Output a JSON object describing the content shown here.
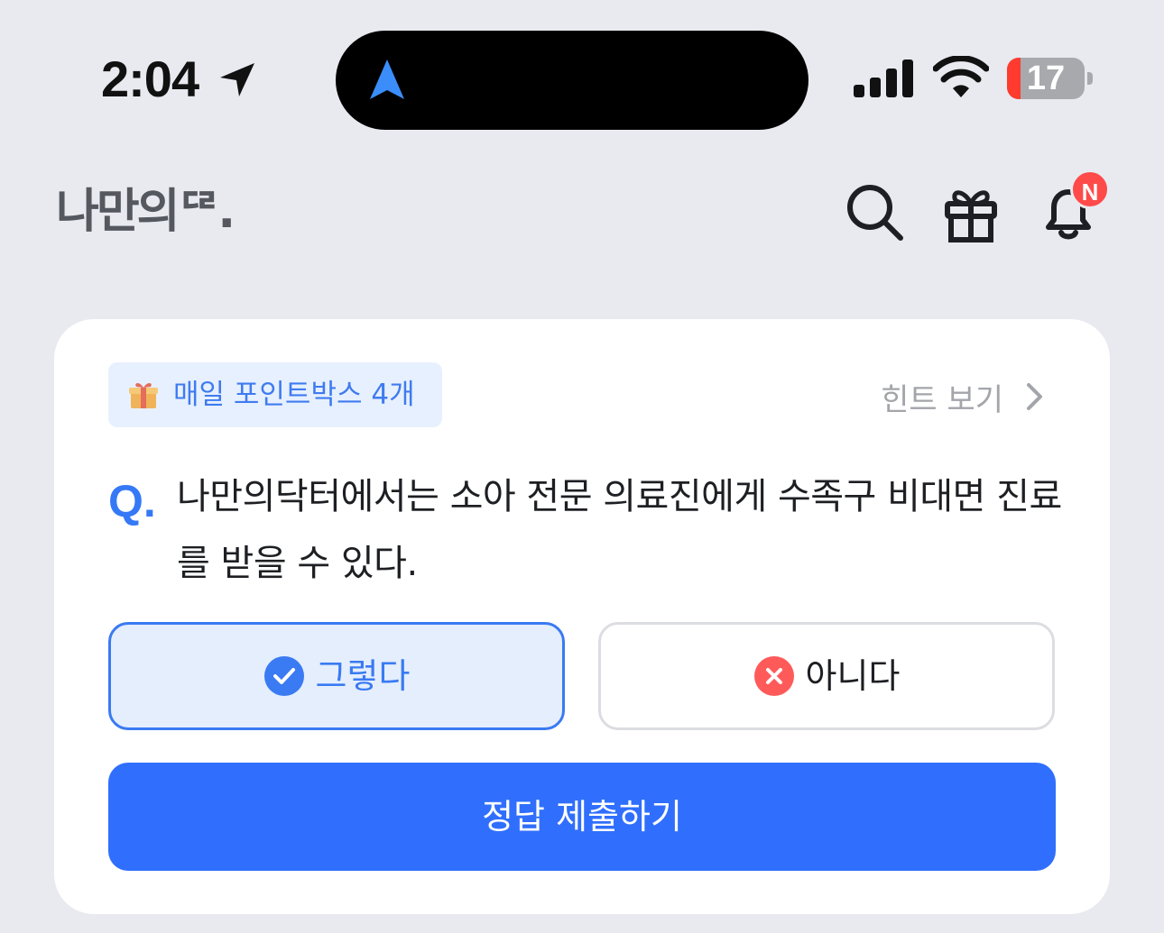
{
  "status_bar": {
    "time": "2:04",
    "battery_level": 17,
    "battery_label": "17"
  },
  "header": {
    "logo_text": "나만의ᄃᄅ."
  },
  "notification_badge": "N",
  "quiz": {
    "pointbox_label": "매일 포인트박스 4개",
    "hint_label": "힌트 보기",
    "q_marker": "Q.",
    "question": "나만의닥터에서는 소아 전문 의료진에게 수족구 비대면 진료를 받을 수 있다.",
    "yes_label": "그렇다",
    "no_label": "아니다",
    "selected": "yes",
    "submit_label": "정답 제출하기"
  },
  "colors": {
    "accent": "#306ffd",
    "selected_blue": "#3a7af2",
    "badge_red": "#ff4a4a",
    "background": "#e9eaf0"
  }
}
